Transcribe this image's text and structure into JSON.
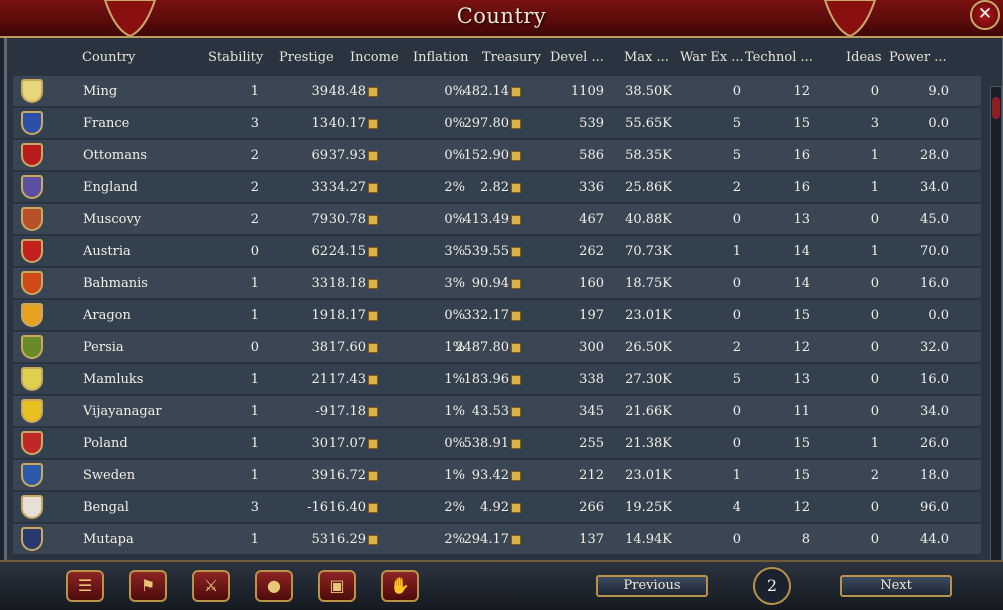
{
  "window": {
    "title": "Country"
  },
  "columns": {
    "country": "Country",
    "stability": "Stability",
    "prestige": "Prestige",
    "income": "Income",
    "inflation": "Inflation",
    "treasury": "Treasury",
    "development": "Devel ...",
    "max": "Max  ...",
    "war_ex": "War Ex ...",
    "technology": "Technol ...",
    "ideas": "Ideas",
    "power": "Power  ..."
  },
  "rows": [
    {
      "country": "Ming",
      "stability": "1",
      "prestige": "39",
      "income": "48.48",
      "inflation": "0%",
      "treasury": "482.14",
      "development": "1109",
      "max": "38.50K",
      "war_ex": "0",
      "technology": "12",
      "ideas": "0",
      "power": "9.0",
      "flag_color": "#e8d67a"
    },
    {
      "country": "France",
      "stability": "3",
      "prestige": "13",
      "income": "40.17",
      "inflation": "0%",
      "treasury": "297.80",
      "development": "539",
      "max": "55.65K",
      "war_ex": "5",
      "technology": "15",
      "ideas": "3",
      "power": "0.0",
      "flag_color": "#2d4fa8"
    },
    {
      "country": "Ottomans",
      "stability": "2",
      "prestige": "69",
      "income": "37.93",
      "inflation": "0%",
      "treasury": "152.90",
      "development": "586",
      "max": "58.35K",
      "war_ex": "5",
      "technology": "16",
      "ideas": "1",
      "power": "28.0",
      "flag_color": "#b81c1c"
    },
    {
      "country": "England",
      "stability": "2",
      "prestige": "33",
      "income": "34.27",
      "inflation": "2%",
      "treasury": "2.82",
      "development": "336",
      "max": "25.86K",
      "war_ex": "2",
      "technology": "16",
      "ideas": "1",
      "power": "34.0",
      "flag_color": "#5a4fa0"
    },
    {
      "country": "Muscovy",
      "stability": "2",
      "prestige": "79",
      "income": "30.78",
      "inflation": "0%",
      "treasury": "413.49",
      "development": "467",
      "max": "40.88K",
      "war_ex": "0",
      "technology": "13",
      "ideas": "0",
      "power": "45.0",
      "flag_color": "#b8502a"
    },
    {
      "country": "Austria",
      "stability": "0",
      "prestige": "62",
      "income": "24.15",
      "inflation": "3%",
      "treasury": "539.55",
      "development": "262",
      "max": "70.73K",
      "war_ex": "1",
      "technology": "14",
      "ideas": "1",
      "power": "70.0",
      "flag_color": "#c42020"
    },
    {
      "country": "Bahmanis",
      "stability": "1",
      "prestige": "33",
      "income": "18.18",
      "inflation": "3%",
      "treasury": "90.94",
      "development": "160",
      "max": "18.75K",
      "war_ex": "0",
      "technology": "14",
      "ideas": "0",
      "power": "16.0",
      "flag_color": "#d04a18"
    },
    {
      "country": "Aragon",
      "stability": "1",
      "prestige": "19",
      "income": "18.17",
      "inflation": "0%",
      "treasury": "332.17",
      "development": "197",
      "max": "23.01K",
      "war_ex": "0",
      "technology": "15",
      "ideas": "0",
      "power": "0.0",
      "flag_color": "#e8a020"
    },
    {
      "country": "Persia",
      "stability": "0",
      "prestige": "38",
      "income": "17.60",
      "inflation": "1%",
      "treasury": "2487.80",
      "development": "300",
      "max": "26.50K",
      "war_ex": "2",
      "technology": "12",
      "ideas": "0",
      "power": "32.0",
      "flag_color": "#6a8a2a"
    },
    {
      "country": "Mamluks",
      "stability": "1",
      "prestige": "21",
      "income": "17.43",
      "inflation": "1%",
      "treasury": "183.96",
      "development": "338",
      "max": "27.30K",
      "war_ex": "5",
      "technology": "13",
      "ideas": "0",
      "power": "16.0",
      "flag_color": "#e0d050"
    },
    {
      "country": "Vijayanagar",
      "stability": "1",
      "prestige": "-9",
      "income": "17.18",
      "inflation": "1%",
      "treasury": "43.53",
      "development": "345",
      "max": "21.66K",
      "war_ex": "0",
      "technology": "11",
      "ideas": "0",
      "power": "34.0",
      "flag_color": "#e8c020"
    },
    {
      "country": "Poland",
      "stability": "1",
      "prestige": "30",
      "income": "17.07",
      "inflation": "0%",
      "treasury": "538.91",
      "development": "255",
      "max": "21.38K",
      "war_ex": "0",
      "technology": "15",
      "ideas": "1",
      "power": "26.0",
      "flag_color": "#c02828"
    },
    {
      "country": "Sweden",
      "stability": "1",
      "prestige": "39",
      "income": "16.72",
      "inflation": "1%",
      "treasury": "93.42",
      "development": "212",
      "max": "23.01K",
      "war_ex": "1",
      "technology": "15",
      "ideas": "2",
      "power": "18.0",
      "flag_color": "#2c5aa8"
    },
    {
      "country": "Bengal",
      "stability": "3",
      "prestige": "-16",
      "income": "16.40",
      "inflation": "2%",
      "treasury": "4.92",
      "development": "266",
      "max": "19.25K",
      "war_ex": "4",
      "technology": "12",
      "ideas": "0",
      "power": "96.0",
      "flag_color": "#e8e0d8"
    },
    {
      "country": "Mutapa",
      "stability": "1",
      "prestige": "53",
      "income": "16.29",
      "inflation": "2%",
      "treasury": "294.17",
      "development": "137",
      "max": "14.94K",
      "war_ex": "0",
      "technology": "8",
      "ideas": "0",
      "power": "44.0",
      "flag_color": "#2a3a70"
    }
  ],
  "footer": {
    "previous_label": "Previous",
    "next_label": "Next",
    "page_number": "2",
    "tools": [
      {
        "icon": "ledger-icon",
        "glyph": "☰"
      },
      {
        "icon": "flag-icon",
        "glyph": "⚑"
      },
      {
        "icon": "crossed-swords-icon",
        "glyph": "⚔"
      },
      {
        "icon": "coins-icon",
        "glyph": "●"
      },
      {
        "icon": "crate-icon",
        "glyph": "▣"
      },
      {
        "icon": "handshake-icon",
        "glyph": "✋"
      }
    ]
  },
  "close_glyph": "✕"
}
